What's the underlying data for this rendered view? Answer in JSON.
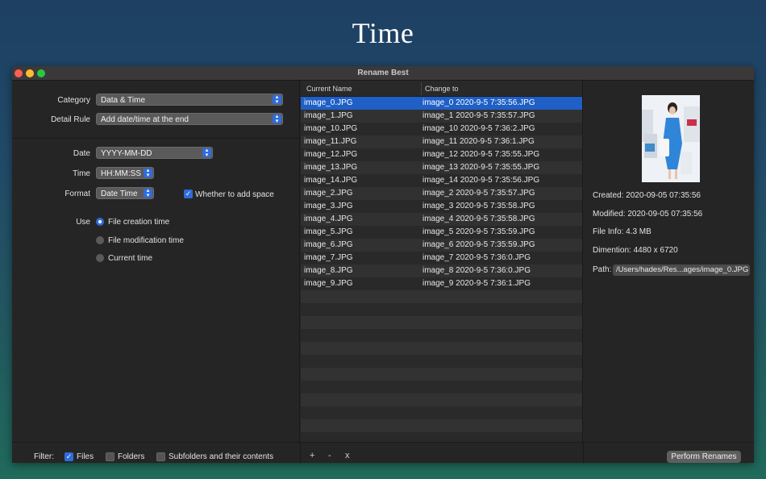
{
  "hero": {
    "title": "Time"
  },
  "window": {
    "title": "Rename Best"
  },
  "left": {
    "category_label": "Category",
    "category_value": "Data & Time",
    "detail_rule_label": "Detail Rule",
    "detail_rule_value": "Add date/time at the end",
    "date_label": "Date",
    "date_value": "YYYY-MM-DD",
    "time_label": "Time",
    "time_value": "HH:MM:SS",
    "format_label": "Format",
    "format_value": "Date Time",
    "add_space_label": "Whether to add space",
    "add_space_checked": true,
    "use_label": "Use",
    "use_options": [
      {
        "label": "File creation time",
        "selected": true
      },
      {
        "label": "File modification time",
        "selected": false
      },
      {
        "label": "Current time",
        "selected": false
      }
    ]
  },
  "table": {
    "col_current": "Current Name",
    "col_change": "Change to",
    "rows": [
      {
        "current": "image_0.JPG",
        "change": "image_0 2020-9-5 7:35:56.JPG",
        "selected": true
      },
      {
        "current": "image_1.JPG",
        "change": "image_1 2020-9-5 7:35:57.JPG"
      },
      {
        "current": "image_10.JPG",
        "change": "image_10 2020-9-5 7:36:2.JPG"
      },
      {
        "current": "image_11.JPG",
        "change": "image_11 2020-9-5 7:36:1.JPG"
      },
      {
        "current": "image_12.JPG",
        "change": "image_12 2020-9-5 7:35:55.JPG"
      },
      {
        "current": "image_13.JPG",
        "change": "image_13 2020-9-5 7:35:55.JPG"
      },
      {
        "current": "image_14.JPG",
        "change": "image_14 2020-9-5 7:35:56.JPG"
      },
      {
        "current": "image_2.JPG",
        "change": "image_2 2020-9-5 7:35:57.JPG"
      },
      {
        "current": "image_3.JPG",
        "change": "image_3 2020-9-5 7:35:58.JPG"
      },
      {
        "current": "image_4.JPG",
        "change": "image_4 2020-9-5 7:35:58.JPG"
      },
      {
        "current": "image_5.JPG",
        "change": "image_5 2020-9-5 7:35:59.JPG"
      },
      {
        "current": "image_6.JPG",
        "change": "image_6 2020-9-5 7:35:59.JPG"
      },
      {
        "current": "image_7.JPG",
        "change": "image_7 2020-9-5 7:36:0.JPG"
      },
      {
        "current": "image_8.JPG",
        "change": "image_8 2020-9-5 7:36:0.JPG"
      },
      {
        "current": "image_9.JPG",
        "change": "image_9 2020-9-5 7:36:1.JPG"
      }
    ]
  },
  "info": {
    "created": "Created: 2020-09-05 07:35:56",
    "modified": "Modified: 2020-09-05 07:35:56",
    "file_info": "File Info: 4.3 MB",
    "dimension": "Dimention: 4480 x 6720",
    "path_label": "Path:",
    "path_value": "/Users/hades/Res...ages/image_0.JPG"
  },
  "bottom": {
    "filter_label": "Filter:",
    "files_label": "Files",
    "files_checked": true,
    "folders_label": "Folders",
    "folders_checked": false,
    "subfolders_label": "Subfolders and their contents",
    "subfolders_checked": false,
    "add_symbol": "+",
    "remove_symbol": "-",
    "clear_symbol": "x",
    "perform_label": "Perform Renames"
  },
  "colors": {
    "accent": "#2f6cdc",
    "selection": "#1f5fc6",
    "window_bg": "#262525"
  }
}
